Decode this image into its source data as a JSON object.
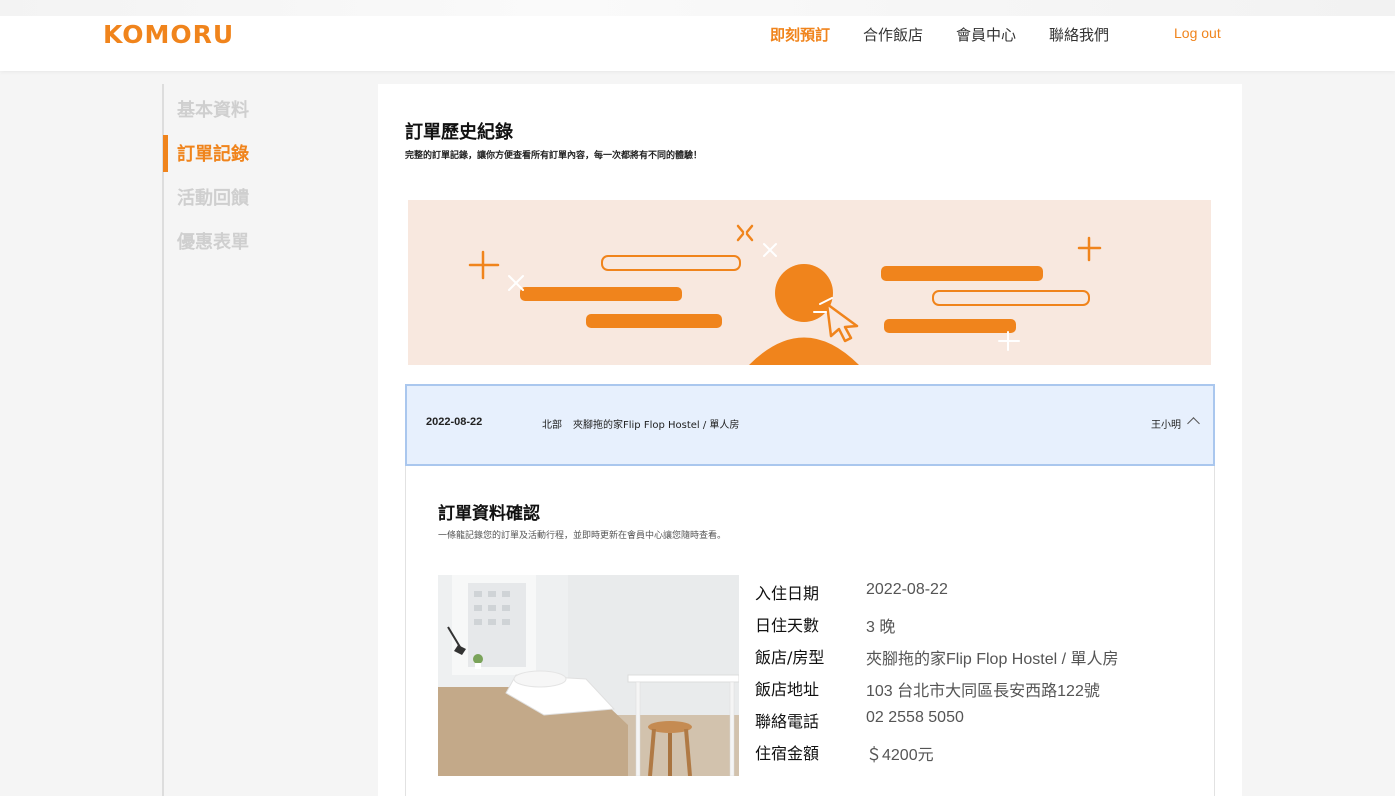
{
  "header": {
    "logo": "KOMORU",
    "nav": [
      {
        "label": "即刻預訂",
        "active": true
      },
      {
        "label": "合作飯店",
        "active": false
      },
      {
        "label": "會員中心",
        "active": false
      },
      {
        "label": "聯絡我們",
        "active": false
      }
    ],
    "logout": "Log out"
  },
  "sidebar": {
    "items": [
      {
        "label": "基本資料",
        "active": false
      },
      {
        "label": "訂單記錄",
        "active": true
      },
      {
        "label": "活動回饋",
        "active": false
      },
      {
        "label": "優惠表單",
        "active": false
      }
    ]
  },
  "main": {
    "title": "訂單歷史紀錄",
    "subtitle": "完整的訂單記錄，讓你方便查看所有訂單內容，每一次都將有不同的體驗！"
  },
  "order": {
    "date": "2022-08-22",
    "region": "北部",
    "hotel": "夾腳拖的家Flip Flop Hostel / 單人房",
    "guest": "王小明"
  },
  "detail": {
    "title": "訂單資料確認",
    "subtitle": "一條龍記錄您的訂單及活動行程，並即時更新在會員中心讓您隨時查看。",
    "rows": [
      {
        "label": "入住日期",
        "value": "2022-08-22"
      },
      {
        "label": "日住天數",
        "value": "3 晚"
      },
      {
        "label": "飯店/房型",
        "value": "夾腳拖的家Flip Flop Hostel / 單人房"
      },
      {
        "label": "飯店地址",
        "value": "103 台北市大同區長安西路122號"
      },
      {
        "label": "聯絡電話",
        "value": "02 2558 5050"
      },
      {
        "label": "住宿金額",
        "value": "＄4200元"
      }
    ]
  },
  "colors": {
    "accent": "#f0841c",
    "banner_bg": "#f8e8df",
    "order_head_bg": "#e7f0fd"
  }
}
